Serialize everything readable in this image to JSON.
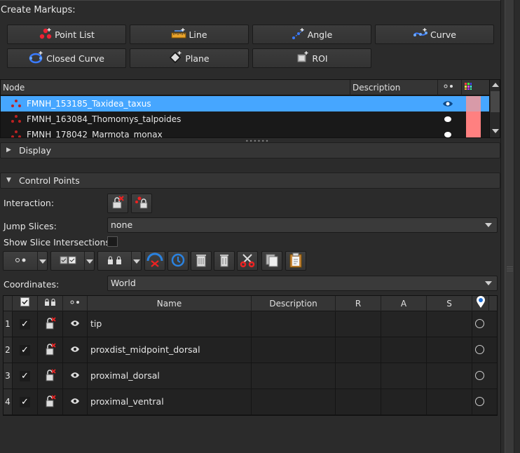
{
  "create_markups": {
    "label": "Create Markups:",
    "buttons": [
      {
        "id": "point-list",
        "label": "Point List",
        "icon": "point-list-icon"
      },
      {
        "id": "line",
        "label": "Line",
        "icon": "ruler-icon"
      },
      {
        "id": "angle",
        "label": "Angle",
        "icon": "angle-icon"
      },
      {
        "id": "curve",
        "label": "Curve",
        "icon": "curve-icon"
      },
      {
        "id": "closed-curve",
        "label": "Closed Curve",
        "icon": "closed-curve-icon"
      },
      {
        "id": "plane",
        "label": "Plane",
        "icon": "plane-icon"
      },
      {
        "id": "roi",
        "label": "ROI",
        "icon": "roi-icon"
      }
    ]
  },
  "node_table": {
    "headers": {
      "node": "Node",
      "description": "Description"
    },
    "rows": [
      {
        "name": "FMNH_153185_Taxidea_taxus",
        "selected": true,
        "color": "#d89aa8"
      },
      {
        "name": "FMNH_163084_Thomomys_talpoides",
        "selected": false,
        "color": "#ff8080"
      },
      {
        "name": "FMNH_178042_Marmota_monax",
        "selected": false,
        "color": "#ff8080"
      }
    ]
  },
  "display_section": {
    "label": "Display"
  },
  "control_points": {
    "label": "Control Points",
    "interaction_label": "Interaction:",
    "jump_slices_label": "Jump Slices:",
    "jump_slices_value": "none",
    "show_slice_intersections_label": "Show Slice Intersections:",
    "coordinates_label": "Coordinates:",
    "coordinates_value": "World",
    "table": {
      "headers": {
        "name": "Name",
        "description": "Description",
        "r": "R",
        "a": "A",
        "s": "S"
      },
      "rows": [
        {
          "num": "1",
          "check": "✓",
          "name": "tip"
        },
        {
          "num": "2",
          "check": "✓",
          "name": "proxdist_midpoint_dorsal"
        },
        {
          "num": "3",
          "check": "✓",
          "name": "proximal_dorsal"
        },
        {
          "num": "4",
          "check": "✓",
          "name": "proximal_ventral"
        }
      ]
    }
  },
  "colors": {
    "selection": "#46a6ff",
    "swatch": "#ff8080",
    "accent": "#1f6fd6"
  }
}
